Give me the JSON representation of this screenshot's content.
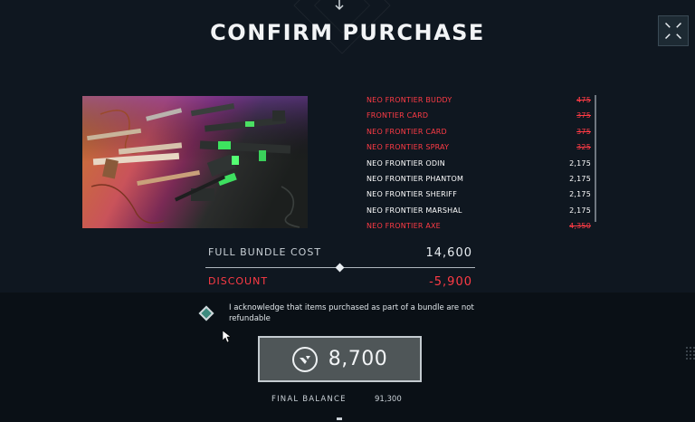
{
  "title": "CONFIRM PURCHASE",
  "close_icon": "close-corners-icon",
  "bundle_items": [
    {
      "name": "NEO FRONTIER BUDDY",
      "price": "475",
      "owned": true
    },
    {
      "name": "FRONTIER CARD",
      "price": "375",
      "owned": true
    },
    {
      "name": "NEO FRONTIER CARD",
      "price": "375",
      "owned": true
    },
    {
      "name": "NEO FRONTIER SPRAY",
      "price": "325",
      "owned": true
    },
    {
      "name": "NEO FRONTIER ODIN",
      "price": "2,175",
      "owned": false
    },
    {
      "name": "NEO FRONTIER PHANTOM",
      "price": "2,175",
      "owned": false
    },
    {
      "name": "NEO FRONTIER SHERIFF",
      "price": "2,175",
      "owned": false
    },
    {
      "name": "NEO FRONTIER MARSHAL",
      "price": "2,175",
      "owned": false
    },
    {
      "name": "NEO FRONTIER AXE",
      "price": "4,350",
      "owned": true
    }
  ],
  "summary": {
    "full_cost_label": "FULL BUNDLE COST",
    "full_cost_value": "14,600",
    "discount_label": "DISCOUNT",
    "discount_value": "-5,900"
  },
  "acknowledge_text": "I acknowledge that items purchased as part of a bundle are not refundable",
  "purchase": {
    "price": "8,700",
    "currency_icon": "valorant-points-icon"
  },
  "balance": {
    "label": "FINAL BALANCE",
    "value": "91,300"
  },
  "colors": {
    "owned_red": "#ff3b45",
    "background": "#0f1720",
    "check_teal": "#3d8a7e"
  }
}
